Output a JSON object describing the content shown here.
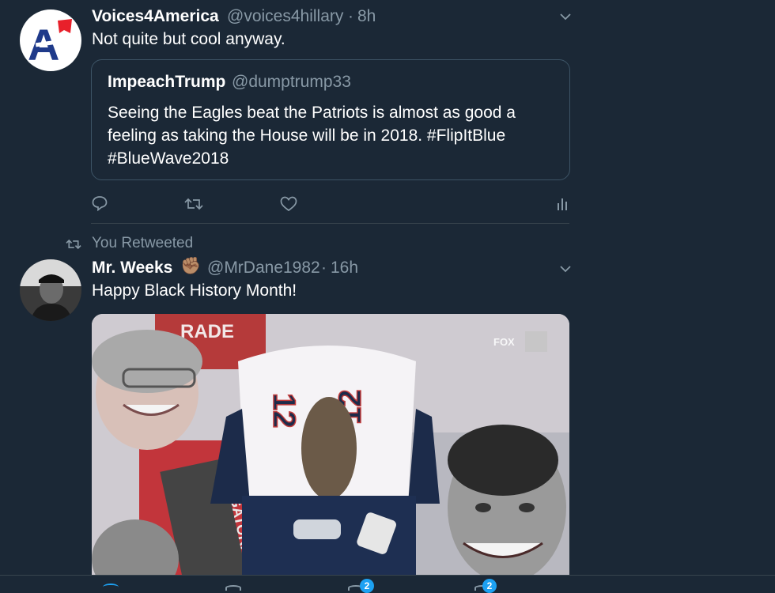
{
  "tweet1": {
    "display_name": "Voices4America",
    "handle": "@voices4hillary",
    "separator": "·",
    "time": "8h",
    "text": "Not quite but cool anyway.",
    "avatar_letter": "A",
    "quoted": {
      "display_name": "ImpeachTrump",
      "handle": "@dumptrump33",
      "text_line1": "Seeing the Eagles beat the Patriots is almost as good a",
      "text_line2": "feeling as taking the House will be in 2018. #FlipItBlue",
      "text_line3": "#BlueWave2018"
    }
  },
  "retweet_context": {
    "label": "You Retweeted"
  },
  "tweet2": {
    "display_name": "Mr. Weeks",
    "emoji": "✊🏽",
    "handle": "@MrDane1982",
    "separator": "·",
    "time": "16h",
    "text": "Happy Black History Month!",
    "media": {
      "jersey_number": "12",
      "banner_text": "RADE",
      "side_text": "GATORADE",
      "broadcaster": "FOX"
    }
  },
  "bottom_bar": {
    "badges": [
      "2",
      "2"
    ]
  },
  "colors": {
    "background": "#1b2836",
    "secondary_text": "#8899a6",
    "accent": "#1da1f2",
    "divider": "#38444d"
  }
}
